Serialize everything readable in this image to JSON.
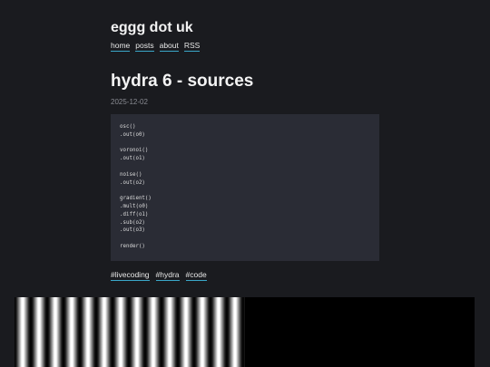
{
  "site": {
    "title": "eggg dot uk",
    "nav": [
      "home",
      "posts",
      "about",
      "RSS"
    ]
  },
  "post": {
    "title": "hydra 6 - sources",
    "date": "2025-12-02",
    "code_lines": [
      "osc()",
      ".out(o0)",
      "",
      "voronoi()",
      ".out(o1)",
      "",
      "noise()",
      ".out(o2)",
      "",
      "gradient()",
      ".mult(o0)",
      ".diff(o1)",
      ".sub(o2)",
      ".out(o3)",
      "",
      "render()"
    ],
    "tags": [
      "#livecoding",
      "#hydra",
      "#code"
    ]
  },
  "colors": {
    "background": "#1a1b1f",
    "code_background": "#2a2c35",
    "link_underline": "#3aa7c9",
    "date": "#8a8c93"
  }
}
